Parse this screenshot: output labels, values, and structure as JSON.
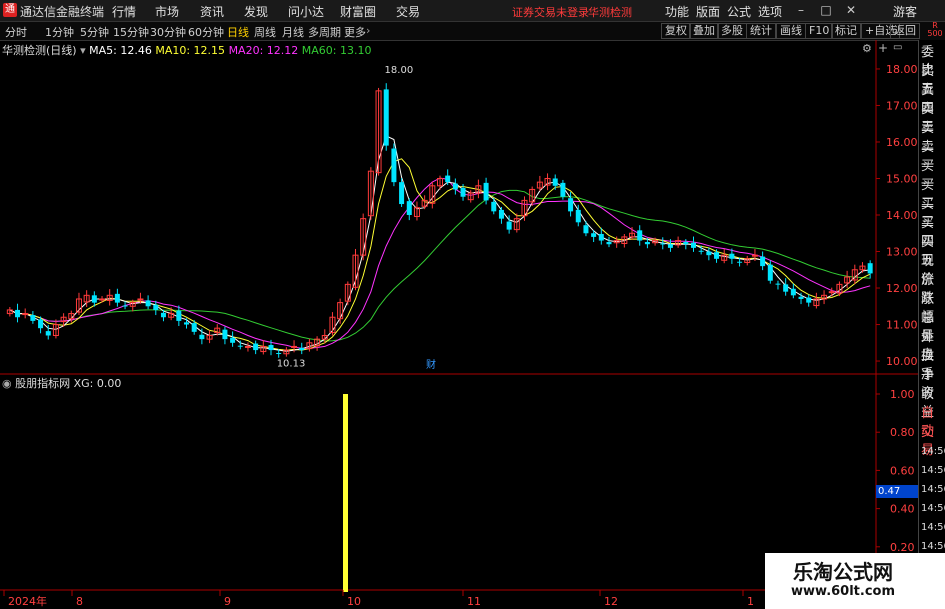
{
  "window": {
    "app_title": "通达信金融终端",
    "menu": [
      "行情",
      "市场",
      "资讯",
      "发现",
      "问小达",
      "财富圈",
      "交易"
    ],
    "warning": "证券交易未登录",
    "stock_tag": "华测检测",
    "right_menu": [
      "功能",
      "版面",
      "公式",
      "选项"
    ],
    "user": "游客",
    "logo_icon": "app-logo-icon"
  },
  "periods": [
    "分时",
    "1分钟",
    "5分钟",
    "15分钟",
    "30分钟",
    "60分钟",
    "日线",
    "周线",
    "月线",
    "多周期",
    "更多"
  ],
  "active_period": "日线",
  "toolbar_right": [
    "复权",
    "叠加",
    "多股",
    "统计",
    "画线",
    "F10",
    "标记",
    "+自选",
    "返回"
  ],
  "corner": {
    "line1": "R",
    "line2": "500"
  },
  "main_chart": {
    "stock_name": "华测检测(日线)",
    "ma5": "MA5: 12.46",
    "ma10": "MA10: 12.15",
    "ma20": "MA20: 12.12",
    "ma60": "MA60: 13.10",
    "high_label": "18.00",
    "low_label": "10.13",
    "event_marker": "财",
    "colors": {
      "up": "#ff3b3b",
      "down": "#00e5ff",
      "ma5": "#ffffff",
      "ma10": "#ffff33",
      "ma20": "#ff33ff",
      "ma60": "#33cc33"
    }
  },
  "sub_chart": {
    "indicator": "股朋指标网",
    "xg": "XG: 0.00",
    "value_tag": "0.47"
  },
  "x_axis": [
    "2024年",
    "8",
    "9",
    "10",
    "11",
    "12",
    "1"
  ],
  "right_panel": [
    "委比",
    "卖五",
    "卖四",
    "卖三",
    "卖二",
    "卖一",
    "买一",
    "买二",
    "买三",
    "买四",
    "买五",
    "现价",
    "涨跌",
    "涨幅",
    "总量",
    "外盘",
    "换手",
    "净资",
    "收益",
    "自动",
    "交易",
    "14:56",
    "14:56",
    "14:56",
    "14:56",
    "14:56",
    "14:56",
    "14:56"
  ],
  "watermark": {
    "title": "乐淘公式网",
    "url": "www.60lt.com"
  },
  "chart_data": [
    {
      "type": "candlestick",
      "title": "华测检测(日线)",
      "y_ticks": [
        "18.00",
        "17.00",
        "16.00",
        "15.00",
        "14.00",
        "13.00",
        "12.00",
        "11.00",
        "10.00"
      ],
      "ylim": [
        9.7,
        18.3
      ],
      "x": [
        "2024年",
        "8",
        "9",
        "10",
        "11",
        "12",
        "1"
      ],
      "closes": [
        11.4,
        11.2,
        11.3,
        11.1,
        10.9,
        10.7,
        11.0,
        11.2,
        11.3,
        11.7,
        11.8,
        11.6,
        11.7,
        11.8,
        11.6,
        11.5,
        11.6,
        11.7,
        11.5,
        11.4,
        11.2,
        11.3,
        11.1,
        11.0,
        10.8,
        10.6,
        10.7,
        10.9,
        10.6,
        10.5,
        10.4,
        10.4,
        10.3,
        10.4,
        10.3,
        10.2,
        10.3,
        10.4,
        10.3,
        10.5,
        10.6,
        10.7,
        11.2,
        11.6,
        12.1,
        12.9,
        13.9,
        15.2,
        17.4,
        15.9,
        14.9,
        14.3,
        14.0,
        14.2,
        14.4,
        14.8,
        15.0,
        14.9,
        14.7,
        14.5,
        14.6,
        14.8,
        14.4,
        14.1,
        13.9,
        13.6,
        13.9,
        14.4,
        14.7,
        14.9,
        15.0,
        14.8,
        14.5,
        14.1,
        13.8,
        13.5,
        13.4,
        13.3,
        13.2,
        13.3,
        13.4,
        13.5,
        13.3,
        13.2,
        13.3,
        13.2,
        13.1,
        13.3,
        13.2,
        13.1,
        13.0,
        12.9,
        12.8,
        12.9,
        12.8,
        12.7,
        12.8,
        12.9,
        12.6,
        12.2,
        12.1,
        11.9,
        11.8,
        11.7,
        11.6,
        11.7,
        11.8,
        11.9,
        12.1,
        12.3,
        12.5,
        12.6,
        12.4
      ],
      "ma_latest": {
        "MA5": 12.46,
        "MA10": 12.15,
        "MA20": 12.12,
        "MA60": 13.1
      },
      "annotations": [
        "18.00",
        "10.13",
        "财"
      ]
    },
    {
      "type": "bar",
      "title": "股朋指标网",
      "y_ticks": [
        "1.00",
        "0.80",
        "0.60",
        "0.40",
        "0.20",
        "0.00"
      ],
      "ylim": [
        0,
        1
      ],
      "series": [
        {
          "name": "XG",
          "signal_at": "10",
          "value": 1.0
        }
      ],
      "latest": 0.47
    }
  ]
}
